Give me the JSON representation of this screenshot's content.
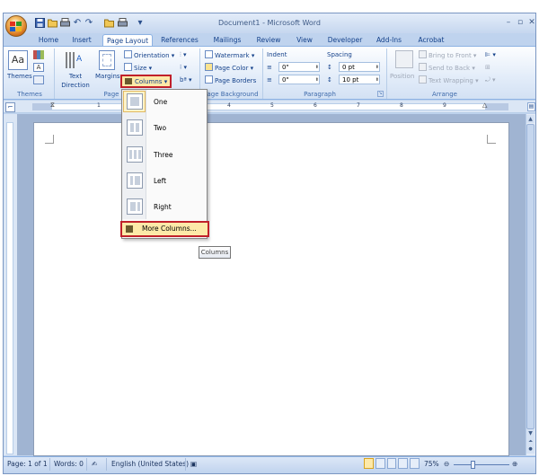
{
  "window": {
    "title": "Document1 - Microsoft Word",
    "controls": [
      "–",
      "▫",
      "✕"
    ]
  },
  "quick_access": [
    "save-icon",
    "undo-icon",
    "redo-icon",
    "open-icon",
    "print-icon"
  ],
  "tabs": [
    {
      "label": "Home",
      "active": false
    },
    {
      "label": "Insert",
      "active": false
    },
    {
      "label": "Page Layout",
      "active": true
    },
    {
      "label": "References",
      "active": false
    },
    {
      "label": "Mailings",
      "active": false
    },
    {
      "label": "Review",
      "active": false
    },
    {
      "label": "View",
      "active": false
    },
    {
      "label": "Developer",
      "active": false
    },
    {
      "label": "Add-Ins",
      "active": false
    },
    {
      "label": "Acrobat",
      "active": false
    }
  ],
  "ribbon": {
    "themes": {
      "label": "Themes",
      "group_label": "Themes"
    },
    "page_setup": {
      "text_direction": "Text Direction",
      "margins": "Margins",
      "orientation": "Orientation",
      "size": "Size",
      "columns": "Columns",
      "group_label": "Page"
    },
    "page_background": {
      "watermark": "Watermark",
      "page_color": "Page Color",
      "page_borders": "Page Borders",
      "group_label": "age Background"
    },
    "paragraph": {
      "indent_label": "Indent",
      "indent_left": "0\"",
      "indent_right": "0\"",
      "spacing_label": "Spacing",
      "spacing_before": "0 pt",
      "spacing_after": "10 pt",
      "group_label": "Paragraph"
    },
    "arrange": {
      "position": "Position",
      "bring_to_front": "Bring to Front",
      "send_to_back": "Send to Back",
      "text_wrapping": "Text Wrapping",
      "group_label": "Arrange"
    }
  },
  "ruler": {
    "numbers": [
      "1",
      "2",
      "3",
      "4",
      "5",
      "6",
      "7",
      "8",
      "9"
    ]
  },
  "columns_menu": {
    "items": [
      {
        "label": "One",
        "cols": 1,
        "selected": true
      },
      {
        "label": "Two",
        "cols": 2,
        "selected": false
      },
      {
        "label": "Three",
        "cols": 3,
        "selected": false
      },
      {
        "label": "Left",
        "cols": 2,
        "selected": false
      },
      {
        "label": "Right",
        "cols": 2,
        "selected": false
      }
    ],
    "more": "More Columns..."
  },
  "tooltip": "Columns",
  "status": {
    "page": "Page: 1 of 1",
    "words": "Words: 0",
    "language": "English (United States)",
    "zoom": "75%"
  }
}
